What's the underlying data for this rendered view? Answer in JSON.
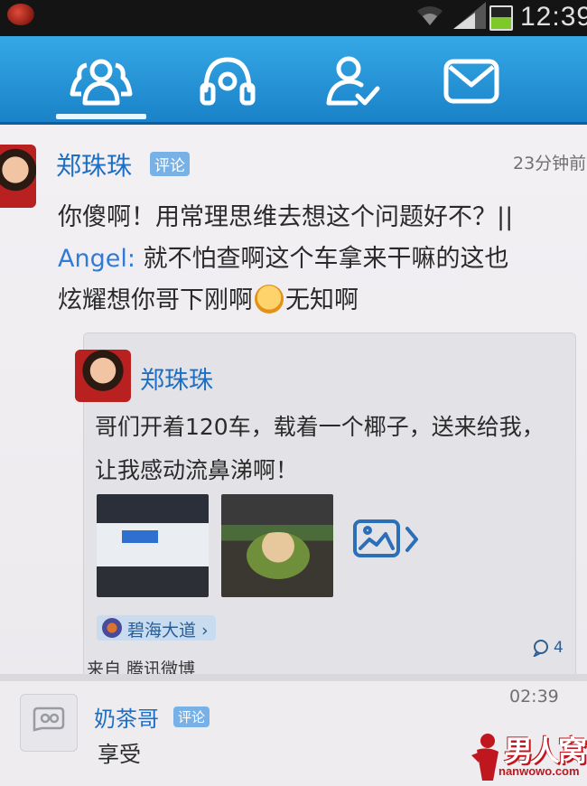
{
  "status_bar": {
    "time": "12:39"
  },
  "tabs": [
    {
      "name": "contacts-icon"
    },
    {
      "name": "headset-icon"
    },
    {
      "name": "user-check-icon"
    },
    {
      "name": "mail-icon"
    }
  ],
  "post": {
    "author": "郑珠珠",
    "tag": "评论",
    "time": "23分钟前",
    "text_line1": "你傻啊！用常理思维去想这个问题好不？||",
    "reply_name": "Angel:",
    "text_line2": " 就不怕查啊这个车拿来干嘛的这也",
    "text_line3a": "炫耀想你哥下刚啊",
    "text_line3b": "无知啊",
    "quote": {
      "author": "郑珠珠",
      "text": "哥们开着120车，载着一个椰子，送来给我，让我感动流鼻涕啊！",
      "location": "碧海大道",
      "comments": "4"
    },
    "source": "来自 腾讯微博"
  },
  "post2": {
    "author": "奶茶哥",
    "tag": "评论",
    "time": "02:39",
    "text": "享受"
  },
  "watermark": {
    "title": "男人窝",
    "url": "nanwowo.com"
  },
  "colors": {
    "accent": "#1c6fc4",
    "tab_bar": "#1a82c8"
  }
}
